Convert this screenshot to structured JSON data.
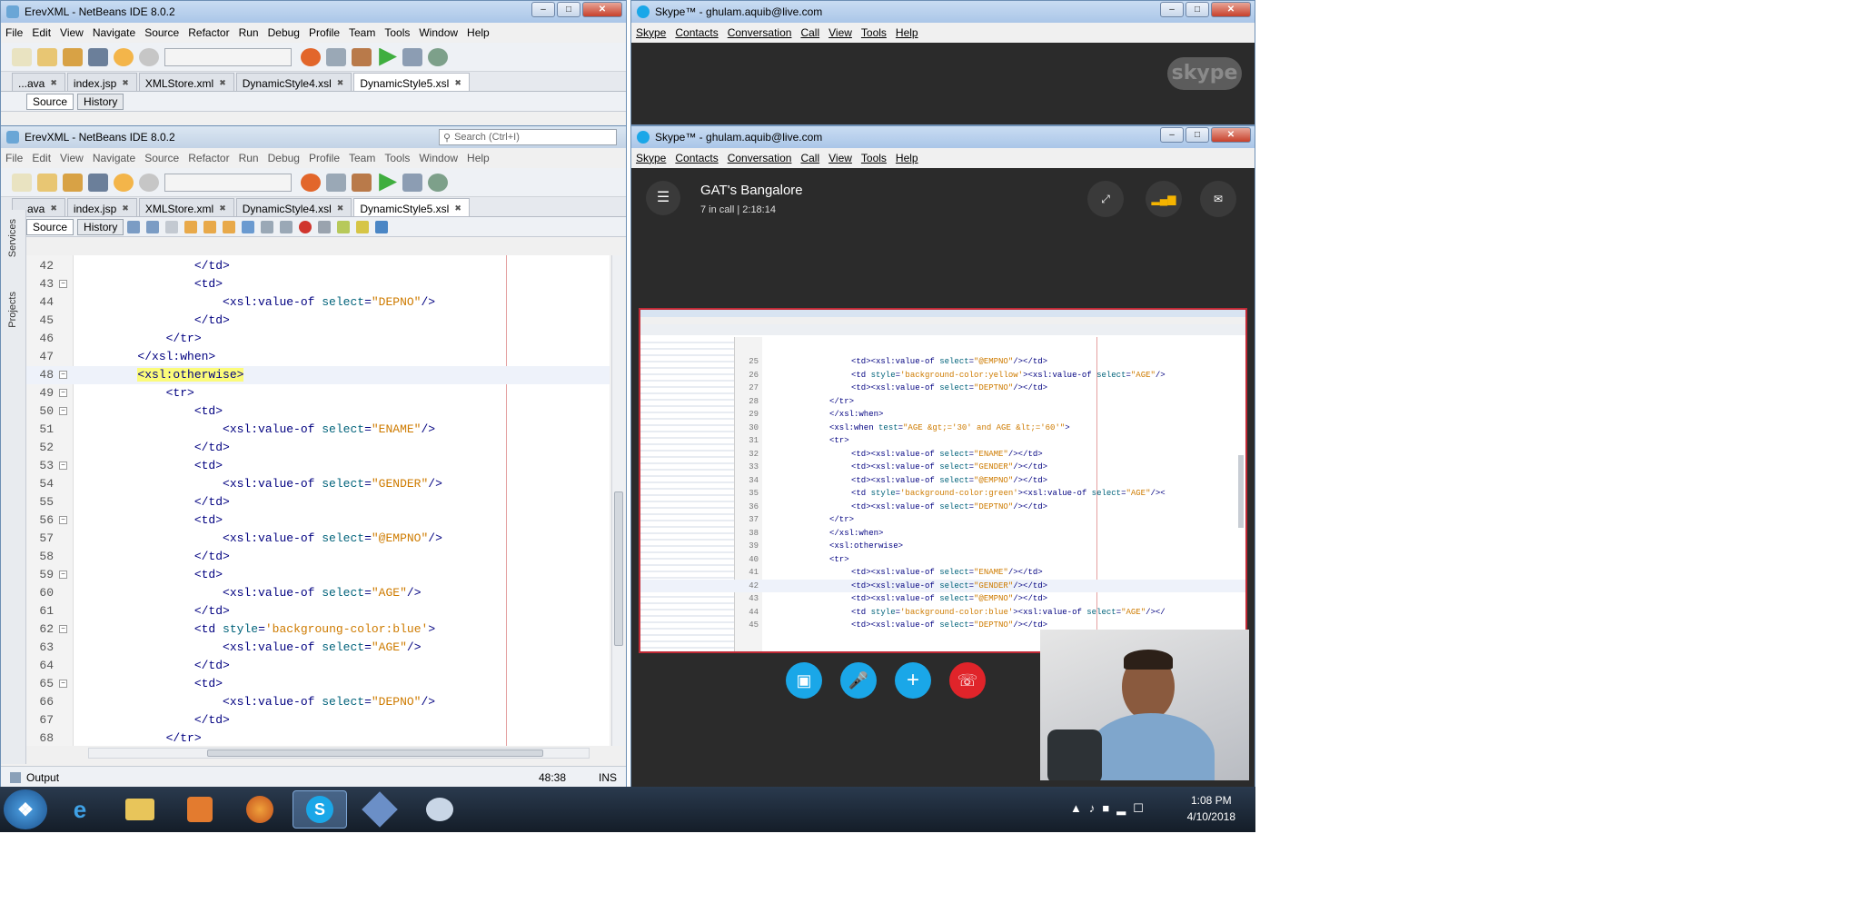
{
  "netbeans_back": {
    "title": "ErevXML - NetBeans IDE 8.0.2",
    "menu": [
      "File",
      "Edit",
      "View",
      "Navigate",
      "Source",
      "Refactor",
      "Run",
      "Debug",
      "Profile",
      "Team",
      "Tools",
      "Window",
      "Help"
    ],
    "search_placeholder": "Search (Ctrl+I)",
    "tabs": [
      "...ava",
      "index.jsp",
      "XMLStore.xml",
      "DynamicStyle4.xsl",
      "DynamicStyle5.xsl"
    ],
    "active_tab": "DynamicStyle5.xsl",
    "source_label": "Source",
    "history_label": "History"
  },
  "netbeans_front": {
    "title": "ErevXML - NetBeans IDE 8.0.2",
    "menu": [
      "File",
      "Edit",
      "View",
      "Navigate",
      "Source",
      "Refactor",
      "Run",
      "Debug",
      "Profile",
      "Team",
      "Tools",
      "Window",
      "Help"
    ],
    "search_placeholder": "Search (Ctrl+I)",
    "tabs": [
      "...ava",
      "index.jsp",
      "XMLStore.xml",
      "DynamicStyle4.xsl",
      "DynamicStyle5.xsl"
    ],
    "source_label": "Source",
    "history_label": "History",
    "side_labels": [
      "Services",
      "Projects"
    ],
    "code_lines": [
      {
        "n": "42",
        "indent": "                ",
        "parts": [
          {
            "t": "</td>",
            "k": "tag"
          }
        ],
        "fold": false
      },
      {
        "n": "43",
        "indent": "                ",
        "parts": [
          {
            "t": "<td>",
            "k": "tag"
          }
        ],
        "fold": true
      },
      {
        "n": "44",
        "indent": "                    ",
        "parts": [
          {
            "t": "<xsl:value-of ",
            "k": "tag"
          },
          {
            "t": "select",
            "k": "attr"
          },
          {
            "t": "=",
            "k": "tag"
          },
          {
            "t": "\"DEPNO\"",
            "k": "str"
          },
          {
            "t": "/>",
            "k": "tag"
          }
        ],
        "fold": false
      },
      {
        "n": "45",
        "indent": "                ",
        "parts": [
          {
            "t": "</td>",
            "k": "tag"
          }
        ],
        "fold": false
      },
      {
        "n": "46",
        "indent": "            ",
        "parts": [
          {
            "t": "</tr>",
            "k": "tag"
          }
        ],
        "fold": false
      },
      {
        "n": "47",
        "indent": "        ",
        "parts": [
          {
            "t": "</xsl:when>",
            "k": "tag"
          }
        ],
        "fold": false
      },
      {
        "n": "48",
        "indent": "        ",
        "parts": [
          {
            "t": "<xsl:otherwise>",
            "k": "hl"
          }
        ],
        "fold": true,
        "current": true
      },
      {
        "n": "49",
        "indent": "            ",
        "parts": [
          {
            "t": "<tr>",
            "k": "tag"
          }
        ],
        "fold": true
      },
      {
        "n": "50",
        "indent": "                ",
        "parts": [
          {
            "t": "<td>",
            "k": "tag"
          }
        ],
        "fold": true
      },
      {
        "n": "51",
        "indent": "                    ",
        "parts": [
          {
            "t": "<xsl:value-of ",
            "k": "tag"
          },
          {
            "t": "select",
            "k": "attr"
          },
          {
            "t": "=",
            "k": "tag"
          },
          {
            "t": "\"ENAME\"",
            "k": "str"
          },
          {
            "t": "/>",
            "k": "tag"
          }
        ],
        "fold": false
      },
      {
        "n": "52",
        "indent": "                ",
        "parts": [
          {
            "t": "</td>",
            "k": "tag"
          }
        ],
        "fold": false
      },
      {
        "n": "53",
        "indent": "                ",
        "parts": [
          {
            "t": "<td>",
            "k": "tag"
          }
        ],
        "fold": true
      },
      {
        "n": "54",
        "indent": "                    ",
        "parts": [
          {
            "t": "<xsl:value-of ",
            "k": "tag"
          },
          {
            "t": "select",
            "k": "attr"
          },
          {
            "t": "=",
            "k": "tag"
          },
          {
            "t": "\"GENDER\"",
            "k": "str"
          },
          {
            "t": "/>",
            "k": "tag"
          }
        ],
        "fold": false
      },
      {
        "n": "55",
        "indent": "                ",
        "parts": [
          {
            "t": "</td>",
            "k": "tag"
          }
        ],
        "fold": false
      },
      {
        "n": "56",
        "indent": "                ",
        "parts": [
          {
            "t": "<td>",
            "k": "tag"
          }
        ],
        "fold": true
      },
      {
        "n": "57",
        "indent": "                    ",
        "parts": [
          {
            "t": "<xsl:value-of ",
            "k": "tag"
          },
          {
            "t": "select",
            "k": "attr"
          },
          {
            "t": "=",
            "k": "tag"
          },
          {
            "t": "\"@EMPNO\"",
            "k": "str"
          },
          {
            "t": "/>",
            "k": "tag"
          }
        ],
        "fold": false
      },
      {
        "n": "58",
        "indent": "                ",
        "parts": [
          {
            "t": "</td>",
            "k": "tag"
          }
        ],
        "fold": false
      },
      {
        "n": "59",
        "indent": "                ",
        "parts": [
          {
            "t": "<td>",
            "k": "tag"
          }
        ],
        "fold": true
      },
      {
        "n": "60",
        "indent": "                    ",
        "parts": [
          {
            "t": "<xsl:value-of ",
            "k": "tag"
          },
          {
            "t": "select",
            "k": "attr"
          },
          {
            "t": "=",
            "k": "tag"
          },
          {
            "t": "\"AGE\"",
            "k": "str"
          },
          {
            "t": "/>",
            "k": "tag"
          }
        ],
        "fold": false
      },
      {
        "n": "61",
        "indent": "                ",
        "parts": [
          {
            "t": "</td>",
            "k": "tag"
          }
        ],
        "fold": false
      },
      {
        "n": "62",
        "indent": "                ",
        "parts": [
          {
            "t": "<td ",
            "k": "tag"
          },
          {
            "t": "style",
            "k": "attr"
          },
          {
            "t": "=",
            "k": "tag"
          },
          {
            "t": "'backgroung-color:blue'",
            "k": "str"
          },
          {
            "t": ">",
            "k": "tag"
          }
        ],
        "fold": true
      },
      {
        "n": "63",
        "indent": "                    ",
        "parts": [
          {
            "t": "<xsl:value-of ",
            "k": "tag"
          },
          {
            "t": "select",
            "k": "attr"
          },
          {
            "t": "=",
            "k": "tag"
          },
          {
            "t": "\"AGE\"",
            "k": "str"
          },
          {
            "t": "/>",
            "k": "tag"
          }
        ],
        "fold": false
      },
      {
        "n": "64",
        "indent": "                ",
        "parts": [
          {
            "t": "</td>",
            "k": "tag"
          }
        ],
        "fold": false
      },
      {
        "n": "65",
        "indent": "                ",
        "parts": [
          {
            "t": "<td>",
            "k": "tag"
          }
        ],
        "fold": true
      },
      {
        "n": "66",
        "indent": "                    ",
        "parts": [
          {
            "t": "<xsl:value-of ",
            "k": "tag"
          },
          {
            "t": "select",
            "k": "attr"
          },
          {
            "t": "=",
            "k": "tag"
          },
          {
            "t": "\"DEPNO\"",
            "k": "str"
          },
          {
            "t": "/>",
            "k": "tag"
          }
        ],
        "fold": false
      },
      {
        "n": "67",
        "indent": "                ",
        "parts": [
          {
            "t": "</td>",
            "k": "tag"
          }
        ],
        "fold": false
      },
      {
        "n": "68",
        "indent": "            ",
        "parts": [
          {
            "t": "</tr>",
            "k": "tag"
          }
        ],
        "fold": false
      }
    ],
    "output_label": "Output",
    "cursor_pos": "48:38",
    "insert_mode": "INS"
  },
  "skype_back": {
    "title": "Skype™ - ghulam.aquib@live.com",
    "menu": [
      "Skype",
      "Contacts",
      "Conversation",
      "Call",
      "View",
      "Tools",
      "Help"
    ],
    "logo": "skype"
  },
  "skype_front": {
    "title": "Skype™ - ghulam.aquib@live.com",
    "menu": [
      "Skype",
      "Contacts",
      "Conversation",
      "Call",
      "View",
      "Tools",
      "Help"
    ],
    "call_name": "GAT's Bangalore",
    "call_status": "7 in call | 2:18:14",
    "shared_lines": [
      {
        "n": "25",
        "indent": "    ",
        "parts": [
          {
            "t": "<td><xsl:value-of ",
            "k": "tag"
          },
          {
            "t": "select",
            "k": "attr"
          },
          {
            "t": "=",
            "k": "tag"
          },
          {
            "t": "\"@EMPNO\"",
            "k": "str"
          },
          {
            "t": "/></td>",
            "k": "tag"
          }
        ]
      },
      {
        "n": "26",
        "indent": "    ",
        "parts": [
          {
            "t": "<td ",
            "k": "tag"
          },
          {
            "t": "style",
            "k": "attr"
          },
          {
            "t": "=",
            "k": "tag"
          },
          {
            "t": "'background-color:yellow'",
            "k": "str"
          },
          {
            "t": "><xsl:value-of ",
            "k": "tag"
          },
          {
            "t": "select",
            "k": "attr"
          },
          {
            "t": "=",
            "k": "tag"
          },
          {
            "t": "\"AGE\"",
            "k": "str"
          },
          {
            "t": "/>",
            "k": "tag"
          }
        ]
      },
      {
        "n": "27",
        "indent": "    ",
        "parts": [
          {
            "t": "<td><xsl:value-of ",
            "k": "tag"
          },
          {
            "t": "select",
            "k": "attr"
          },
          {
            "t": "=",
            "k": "tag"
          },
          {
            "t": "\"DEPTNO\"",
            "k": "str"
          },
          {
            "t": "/></td>",
            "k": "tag"
          }
        ]
      },
      {
        "n": "28",
        "indent": "",
        "parts": [
          {
            "t": "</tr>",
            "k": "tag"
          }
        ]
      },
      {
        "n": "29",
        "indent": "",
        "parts": [
          {
            "t": "</xsl:when>",
            "k": "tag"
          }
        ]
      },
      {
        "n": "30",
        "indent": "",
        "parts": [
          {
            "t": "<xsl:when ",
            "k": "tag"
          },
          {
            "t": "test",
            "k": "attr"
          },
          {
            "t": "=",
            "k": "tag"
          },
          {
            "t": "\"AGE &gt;='30' and AGE &lt;='60'\"",
            "k": "str"
          },
          {
            "t": ">",
            "k": "tag"
          }
        ]
      },
      {
        "n": "31",
        "indent": "",
        "parts": [
          {
            "t": "<tr>",
            "k": "tag"
          }
        ]
      },
      {
        "n": "32",
        "indent": "    ",
        "parts": [
          {
            "t": "<td><xsl:value-of ",
            "k": "tag"
          },
          {
            "t": "select",
            "k": "attr"
          },
          {
            "t": "=",
            "k": "tag"
          },
          {
            "t": "\"ENAME\"",
            "k": "str"
          },
          {
            "t": "/></td>",
            "k": "tag"
          }
        ]
      },
      {
        "n": "33",
        "indent": "    ",
        "parts": [
          {
            "t": "<td><xsl:value-of ",
            "k": "tag"
          },
          {
            "t": "select",
            "k": "attr"
          },
          {
            "t": "=",
            "k": "tag"
          },
          {
            "t": "\"GENDER\"",
            "k": "str"
          },
          {
            "t": "/></td>",
            "k": "tag"
          }
        ]
      },
      {
        "n": "34",
        "indent": "    ",
        "parts": [
          {
            "t": "<td><xsl:value-of ",
            "k": "tag"
          },
          {
            "t": "select",
            "k": "attr"
          },
          {
            "t": "=",
            "k": "tag"
          },
          {
            "t": "\"@EMPNO\"",
            "k": "str"
          },
          {
            "t": "/></td>",
            "k": "tag"
          }
        ]
      },
      {
        "n": "35",
        "indent": "    ",
        "parts": [
          {
            "t": "<td ",
            "k": "tag"
          },
          {
            "t": "style",
            "k": "attr"
          },
          {
            "t": "=",
            "k": "tag"
          },
          {
            "t": "'background-color:green'",
            "k": "str"
          },
          {
            "t": "><xsl:value-of ",
            "k": "tag"
          },
          {
            "t": "select",
            "k": "attr"
          },
          {
            "t": "=",
            "k": "tag"
          },
          {
            "t": "\"AGE\"",
            "k": "str"
          },
          {
            "t": "/><",
            "k": "tag"
          }
        ]
      },
      {
        "n": "36",
        "indent": "    ",
        "parts": [
          {
            "t": "<td><xsl:value-of ",
            "k": "tag"
          },
          {
            "t": "select",
            "k": "attr"
          },
          {
            "t": "=",
            "k": "tag"
          },
          {
            "t": "\"DEPTNO\"",
            "k": "str"
          },
          {
            "t": "/></td>",
            "k": "tag"
          }
        ]
      },
      {
        "n": "37",
        "indent": "",
        "parts": [
          {
            "t": "</tr>",
            "k": "tag"
          }
        ]
      },
      {
        "n": "38",
        "indent": "",
        "parts": [
          {
            "t": "</xsl:when>",
            "k": "tag"
          }
        ]
      },
      {
        "n": "39",
        "indent": "",
        "parts": [
          {
            "t": "<xsl:otherwise>",
            "k": "tag"
          }
        ]
      },
      {
        "n": "40",
        "indent": "",
        "parts": [
          {
            "t": "<tr>",
            "k": "tag"
          }
        ]
      },
      {
        "n": "41",
        "indent": "    ",
        "parts": [
          {
            "t": "<td><xsl:value-of ",
            "k": "tag"
          },
          {
            "t": "select",
            "k": "attr"
          },
          {
            "t": "=",
            "k": "tag"
          },
          {
            "t": "\"ENAME\"",
            "k": "str"
          },
          {
            "t": "/></td>",
            "k": "tag"
          }
        ]
      },
      {
        "n": "42",
        "indent": "    ",
        "parts": [
          {
            "t": "<td><xsl:value-of ",
            "k": "tag"
          },
          {
            "t": "select",
            "k": "attr"
          },
          {
            "t": "=",
            "k": "tag"
          },
          {
            "t": "\"GENDER\"",
            "k": "str"
          },
          {
            "t": "/></td>",
            "k": "tag"
          }
        ],
        "current": true
      },
      {
        "n": "43",
        "indent": "    ",
        "parts": [
          {
            "t": "<td><xsl:value-of ",
            "k": "tag"
          },
          {
            "t": "select",
            "k": "attr"
          },
          {
            "t": "=",
            "k": "tag"
          },
          {
            "t": "\"@EMPNO\"",
            "k": "str"
          },
          {
            "t": "/></td>",
            "k": "tag"
          }
        ]
      },
      {
        "n": "44",
        "indent": "    ",
        "parts": [
          {
            "t": "<td ",
            "k": "tag"
          },
          {
            "t": "style",
            "k": "attr"
          },
          {
            "t": "=",
            "k": "tag"
          },
          {
            "t": "'background-color:blue'",
            "k": "str"
          },
          {
            "t": "><xsl:value-of ",
            "k": "tag"
          },
          {
            "t": "select",
            "k": "attr"
          },
          {
            "t": "=",
            "k": "tag"
          },
          {
            "t": "\"AGE\"",
            "k": "str"
          },
          {
            "t": "/></",
            "k": "tag"
          }
        ]
      },
      {
        "n": "45",
        "indent": "    ",
        "parts": [
          {
            "t": "<td><xsl:value-of ",
            "k": "tag"
          },
          {
            "t": "select",
            "k": "attr"
          },
          {
            "t": "=",
            "k": "tag"
          },
          {
            "t": "\"DEPTNO\"",
            "k": "str"
          },
          {
            "t": "/></td>",
            "k": "tag"
          }
        ]
      }
    ]
  },
  "taskbar": {
    "time": "1:08 PM",
    "date": "4/10/2018",
    "items": [
      "start",
      "internet-explorer",
      "file-explorer",
      "media-player",
      "firefox",
      "skype",
      "virtualbox",
      "paint"
    ]
  },
  "colors": {
    "skype_blue": "#1aa7e8",
    "hangup_red": "#e0242a",
    "highlight_yellow": "#fbfb7a"
  }
}
